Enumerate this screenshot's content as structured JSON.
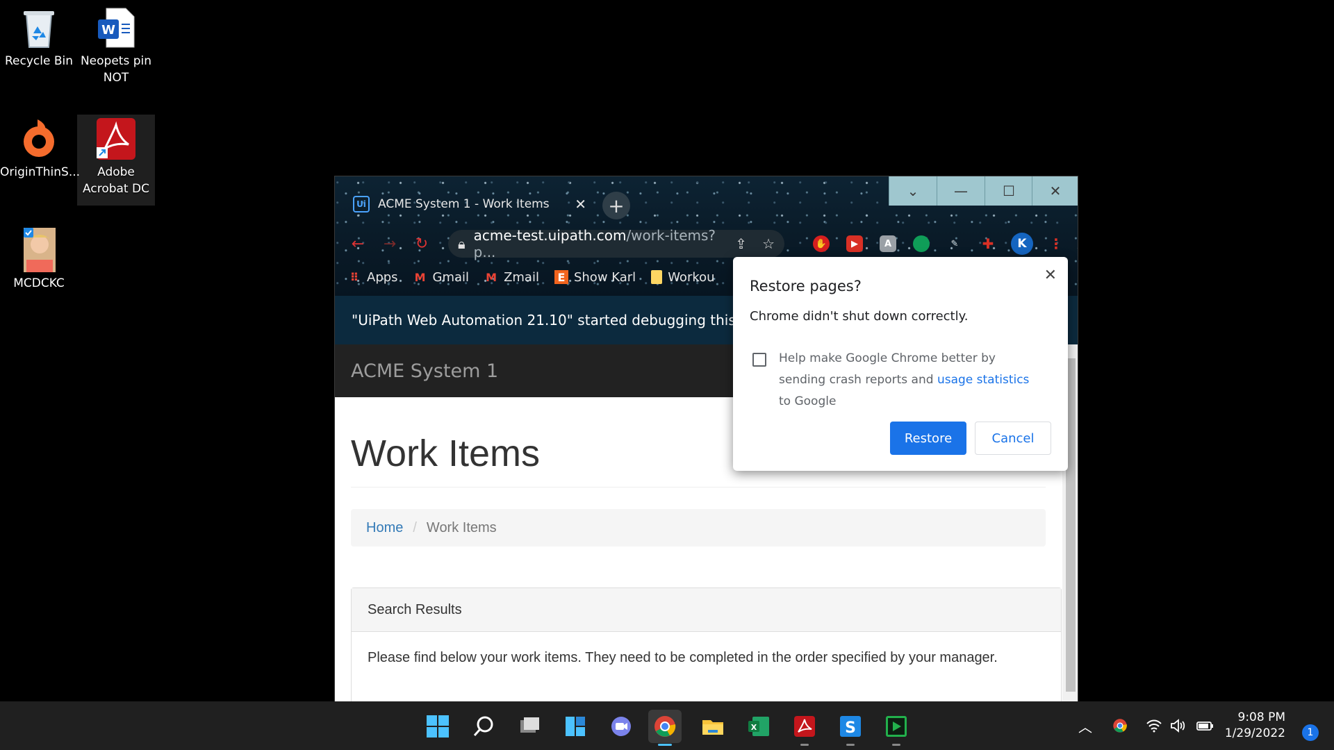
{
  "desktop": {
    "icons": [
      {
        "label_line1": "Recycle Bin",
        "label_line2": ""
      },
      {
        "label_line1": "Neopets pin",
        "label_line2": "NOT"
      },
      {
        "label_line1": "OriginThinS...",
        "label_line2": ""
      },
      {
        "label_line1": "Adobe",
        "label_line2": "Acrobat DC"
      },
      {
        "label_line1": "MCDCKC",
        "label_line2": ""
      }
    ]
  },
  "browser": {
    "tab_title": "ACME System 1 - Work Items",
    "favicon_text": "Ui",
    "window_controls": {
      "dropdown": "⌄",
      "minimize": "—",
      "maximize": "☐",
      "close": "✕"
    },
    "url_host": "acme-test.uipath.com",
    "url_path": "/work-items?p...",
    "profile_initial": "K",
    "bookmarks": [
      "Apps",
      "Gmail",
      "Zmail",
      "Show Karl",
      "Workou"
    ],
    "debug_message": "\"UiPath Web Automation 21.10\" started debugging this browser"
  },
  "app": {
    "brand": "ACME System 1",
    "page_title": "Work Items",
    "breadcrumb": {
      "home": "Home",
      "separator": "/",
      "current": "Work Items"
    },
    "panel": {
      "heading": "Search Results",
      "body": "Please find below your work items. They need to be completed in the order specified by your manager."
    }
  },
  "dialog": {
    "title": "Restore pages?",
    "message": "Chrome didn't shut down correctly.",
    "help_text_pre": "Help make Google Chrome better by sending crash reports and ",
    "help_link": "usage statistics",
    "help_text_post": " to Google",
    "checkbox_checked": false,
    "restore_label": "Restore",
    "cancel_label": "Cancel"
  },
  "taskbar": {
    "clock_time": "9:08 PM",
    "clock_date": "1/29/2022",
    "notification_count": "1"
  },
  "colors": {
    "accent_blue": "#1a73e8",
    "link_blue": "#337ab7",
    "debug_bar": "#0c2a3e",
    "app_nav": "#222222"
  }
}
